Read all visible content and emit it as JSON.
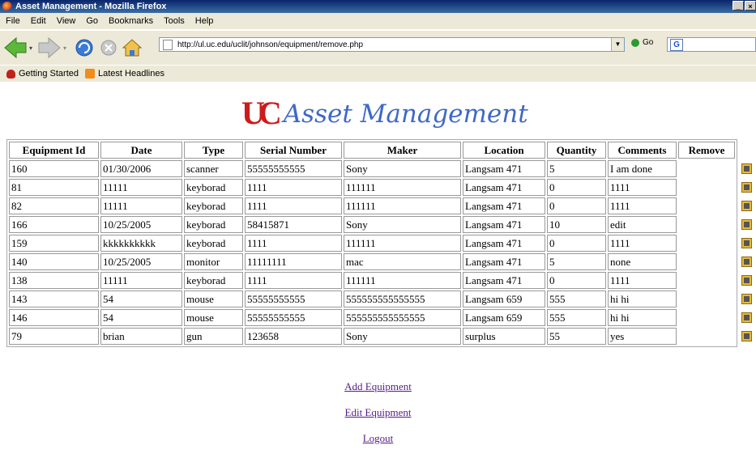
{
  "window": {
    "title": "Asset Management - Mozilla Firefox",
    "controls": [
      "_",
      "×"
    ]
  },
  "menu": [
    "File",
    "Edit",
    "View",
    "Go",
    "Bookmarks",
    "Tools",
    "Help"
  ],
  "nav": {
    "url": "http://ul.uc.edu/uclit/johnson/equipment/remove.php",
    "go_label": "Go",
    "search_placeholder": ""
  },
  "bookmarks": [
    "Getting Started",
    "Latest Headlines"
  ],
  "page": {
    "logo_mark": "UC",
    "logo_text": "Asset Management",
    "table": {
      "headers": [
        "Equipment Id",
        "Date",
        "Type",
        "Serial Number",
        "Maker",
        "Location",
        "Quantity",
        "Comments",
        "Remove"
      ],
      "rows": [
        [
          "160",
          "01/30/2006",
          "scanner",
          "55555555555",
          "Sony",
          "Langsam 471",
          "5",
          "I am done"
        ],
        [
          "81",
          "11111",
          "keyborad",
          "1111",
          "111111",
          "Langsam 471",
          "0",
          "1111"
        ],
        [
          "82",
          "11111",
          "keyborad",
          "1111",
          "111111",
          "Langsam 471",
          "0",
          "1111"
        ],
        [
          "166",
          "10/25/2005",
          "keyborad",
          "58415871",
          "Sony",
          "Langsam 471",
          "10",
          "edit"
        ],
        [
          "159",
          "kkkkkkkkkk",
          "keyborad",
          "1111",
          "111111",
          "Langsam 471",
          "0",
          "1111"
        ],
        [
          "140",
          "10/25/2005",
          "monitor",
          "11111111",
          "mac",
          "Langsam 471",
          "5",
          "none"
        ],
        [
          "138",
          "11111",
          "keyborad",
          "1111",
          "111111",
          "Langsam 471",
          "0",
          "1111"
        ],
        [
          "143",
          "54",
          "mouse",
          "55555555555",
          "555555555555555",
          "Langsam 659",
          "555",
          "hi hi"
        ],
        [
          "146",
          "54",
          "mouse",
          "55555555555",
          "555555555555555",
          "Langsam 659",
          "555",
          "hi hi"
        ],
        [
          "79",
          "brian",
          "gun",
          "123658",
          "Sony",
          "surplus",
          "55",
          "yes"
        ]
      ]
    },
    "links": [
      "Add Equipment",
      "Edit Equipment",
      "Logout"
    ]
  },
  "colors": {
    "logo_red": "#cc1b1b",
    "logo_blue": "#3f68c7",
    "link_visited": "#551a8b"
  }
}
